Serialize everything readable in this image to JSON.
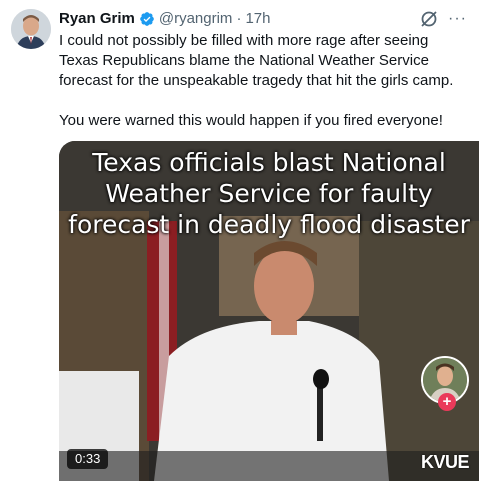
{
  "author": {
    "name": "Ryan Grim",
    "handle": "@ryangrim",
    "time": "17h",
    "separator": "·"
  },
  "tweet": {
    "text": "I could not possibly be filled with more rage after seeing Texas Republicans blame the National Weather Service forecast for the unspeakable tragedy that hit the girls camp.\n\nYou were warned this would happen if you fired everyone!"
  },
  "media": {
    "caption": "Texas officials blast National\nWeather Service for faulty\nforecast in deadly flood disaster",
    "duration": "0:33",
    "watermark": "KVUE"
  },
  "icons": {
    "verified": "verified-badge-icon",
    "grok": "grok-icon",
    "more": "more-icon",
    "plus": "plus-icon"
  },
  "colors": {
    "verified": "#1d9bf0",
    "secondary_text": "#536471",
    "plus": "#ea3a5a"
  },
  "more_glyph": "···",
  "plus_glyph": "+"
}
